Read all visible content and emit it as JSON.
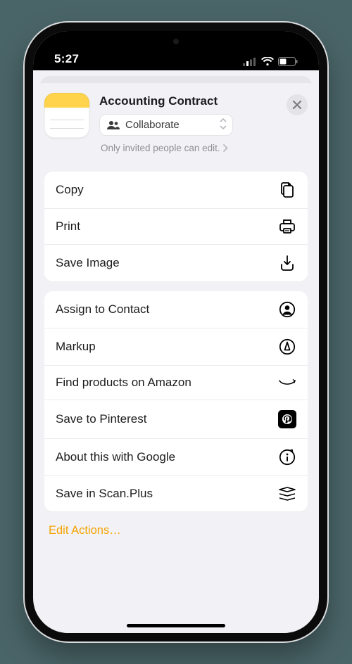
{
  "status": {
    "time": "5:27"
  },
  "colors": {
    "accent": "#f5a300"
  },
  "header": {
    "title": "Accounting Contract",
    "collaborate_label": "Collaborate",
    "subtitle": "Only invited people can edit."
  },
  "group1": [
    {
      "label": "Copy",
      "icon": "copy-icon"
    },
    {
      "label": "Print",
      "icon": "print-icon"
    },
    {
      "label": "Save Image",
      "icon": "save-image-icon"
    }
  ],
  "group2": [
    {
      "label": "Assign to Contact",
      "icon": "contact-icon"
    },
    {
      "label": "Markup",
      "icon": "markup-icon"
    },
    {
      "label": "Find products on Amazon",
      "icon": "amazon-icon"
    },
    {
      "label": "Save to Pinterest",
      "icon": "pinterest-icon"
    },
    {
      "label": "About this with Google",
      "icon": "google-info-icon"
    },
    {
      "label": "Save in Scan.Plus",
      "icon": "scanplus-icon"
    }
  ],
  "edit_actions_label": "Edit Actions…"
}
